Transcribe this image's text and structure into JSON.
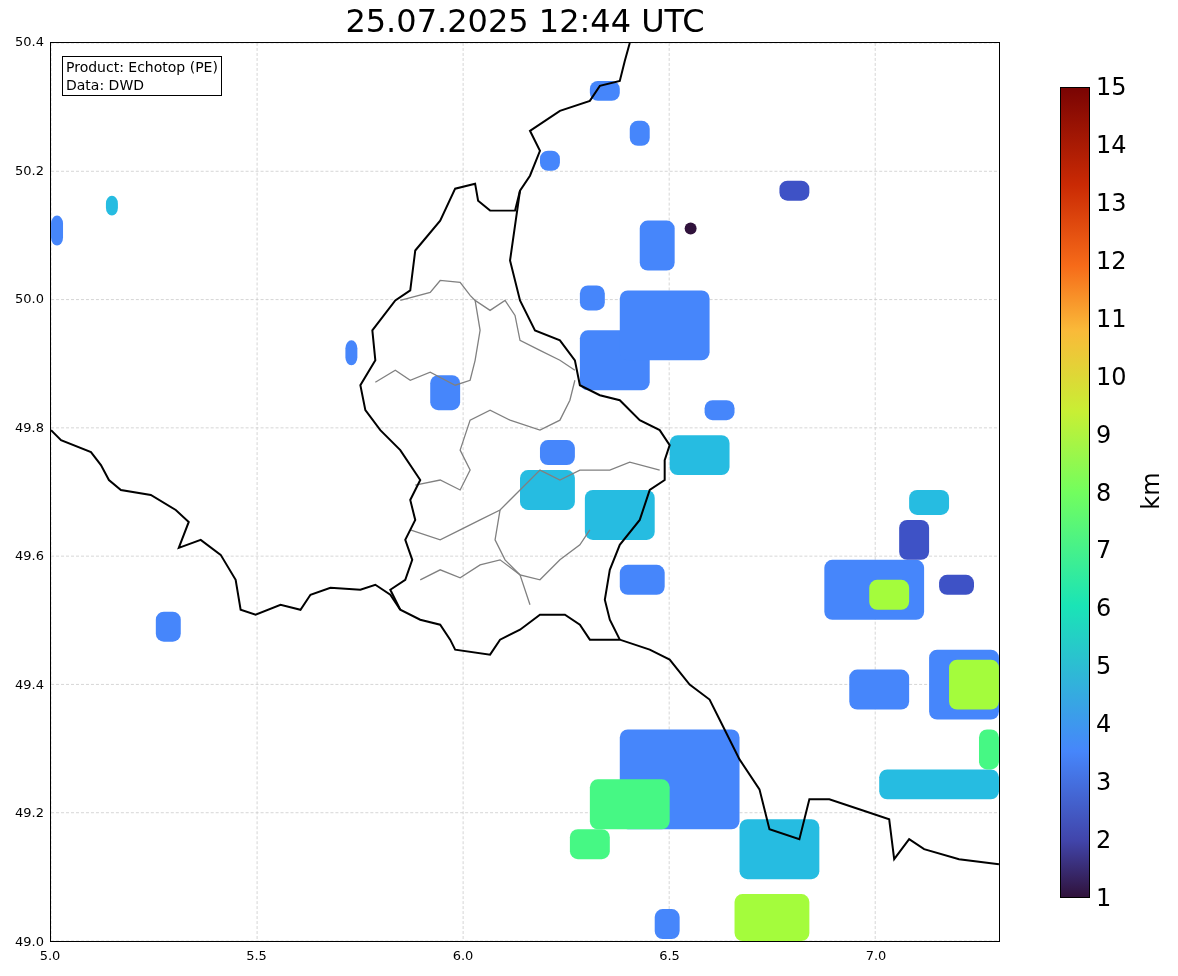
{
  "title": "25.07.2025 12:44 UTC",
  "info_box": {
    "lines": [
      "Product: Echotop (PE)",
      "Data: DWD"
    ]
  },
  "map": {
    "xticks": [
      "5.0",
      "5.5",
      "6.0",
      "6.5",
      "7.0"
    ],
    "yticks": [
      "50.4",
      "50.2",
      "50.0",
      "49.8",
      "49.6",
      "49.4",
      "49.2",
      "49.0"
    ]
  },
  "colorbar": {
    "label": "km",
    "ticks": [
      "15",
      "14",
      "13",
      "12",
      "11",
      "10",
      "9",
      "8",
      "7",
      "6",
      "5",
      "4",
      "3",
      "2",
      "1"
    ]
  }
}
